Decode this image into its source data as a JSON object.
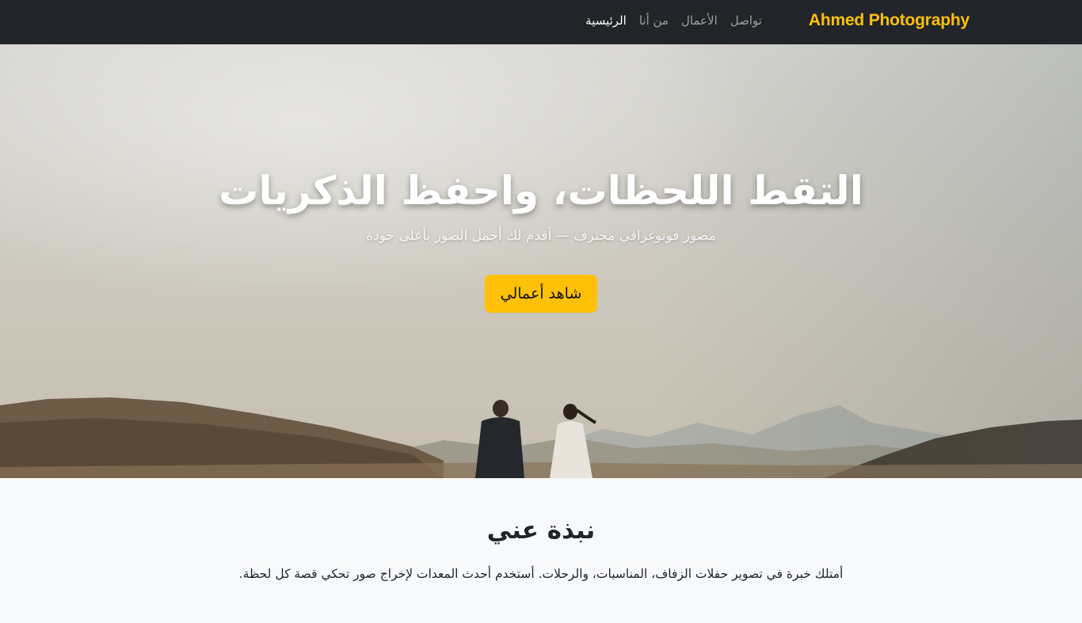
{
  "navbar": {
    "brand": "Ahmed Photography",
    "links": [
      {
        "label": "الرئيسية",
        "active": true
      },
      {
        "label": "من أنا",
        "active": false
      },
      {
        "label": "الأعمال",
        "active": false
      },
      {
        "label": "تواصل",
        "active": false
      }
    ]
  },
  "hero": {
    "title": "التقط اللحظات، واحفظ الذكريات",
    "subtitle": "مصور فوتوغرافي محترف — أقدم لك أجمل الصور بأعلى جودة",
    "cta_label": "شاهد أعمالي"
  },
  "about": {
    "title": "نبذة عني",
    "text": "أمتلك خبرة في تصوير حفلات الزفاف، المناسبات، والرحلات. أستخدم أحدث المعدات لإخراج صور تحكي قصة كل لحظة."
  },
  "colors": {
    "navbar_bg": "#212529",
    "brand": "#ffc107",
    "accent_button": "#ffc107",
    "page_bg": "#f8f9fa"
  }
}
